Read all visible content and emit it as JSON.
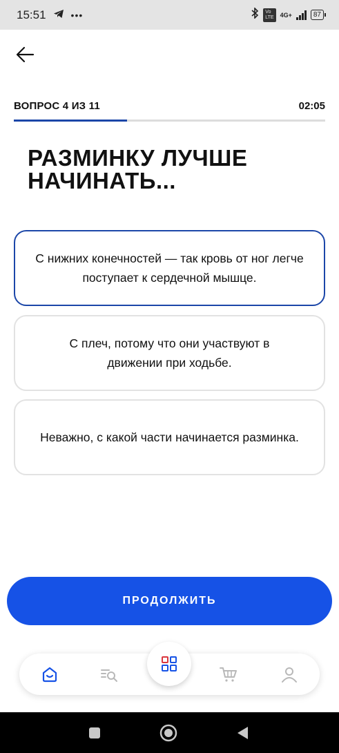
{
  "status_bar": {
    "time": "15:51",
    "network": "4G+",
    "battery": "87"
  },
  "quiz": {
    "counter": "ВОПРОС 4 ИЗ 11",
    "timer": "02:05",
    "progress": 0.364,
    "question": "РАЗМИНКУ ЛУЧШЕ НАЧИНАТЬ...",
    "answers": [
      {
        "text": "С нижних конечностей — так кровь от ног легче поступает к сердечной мышце.",
        "selected": true
      },
      {
        "text": "С плеч, потому что они участвуют в движении при ходьбе.",
        "selected": false
      },
      {
        "text": "Неважно, с какой части начинается разминка.",
        "selected": false
      }
    ],
    "continue_label": "ПРОДОЛЖИТЬ"
  },
  "bottom_nav": {
    "items": [
      "home-icon",
      "catalog-search-icon",
      "grid-menu-icon",
      "cart-icon",
      "profile-icon"
    ],
    "active": "home-icon"
  },
  "colors": {
    "accent": "#1652e6",
    "progress": "#1b46a8",
    "selected_border": "#1b46a8",
    "home_active": "#1652e6",
    "grid_icon": "#d9363e"
  }
}
